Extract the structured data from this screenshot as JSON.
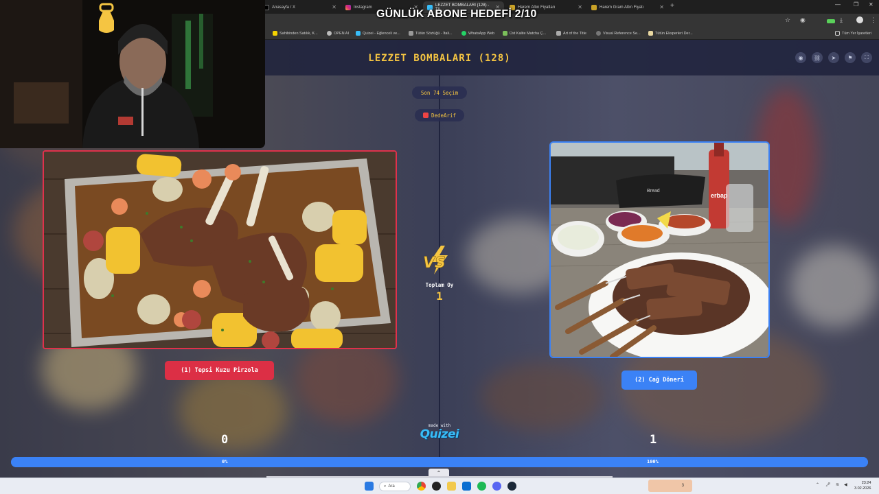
{
  "overlay": {
    "title": "GÜNLÜK ABONE HEDEFİ 2/10"
  },
  "browser": {
    "tabs": [
      {
        "label": "Anasayfa / X"
      },
      {
        "label": "Instagram"
      },
      {
        "label": "LEZZET BOMBALARI (128) - Tü...",
        "active": true
      },
      {
        "label": "Harem Altın Fiyatları"
      },
      {
        "label": "Harem Gram Altın Fiyatı"
      }
    ],
    "bookmarks": [
      "Sahibinden Satılık, K...",
      "OPEN AI",
      "Quizei - Eğlenceli ve...",
      "Tütün Sözlüğü - İtali...",
      "WhatsApp Web",
      "Üst Kalite Matcha Ç...",
      "Art of the Title",
      "Visual Reference Se...",
      "Tütün Eksperleri Der..."
    ],
    "bookmarks_right": "Tüm Yer İşaretleri"
  },
  "quiz": {
    "title": "LEZZET BOMBALARI (128)",
    "round": "Son 74 Seçim",
    "player": "DedeArif",
    "vs": "VS",
    "total_label": "Toplam Oy",
    "total_value": "1",
    "left": {
      "label": "(1) Tepsi Kuzu Pirzola",
      "votes": "0",
      "percent": "0%"
    },
    "right": {
      "label": "(2) Cağ Döneri",
      "votes": "1",
      "percent": "100%"
    },
    "progress_right_fraction": 1.0,
    "made_with": "made with",
    "brand": "Quizei"
  },
  "bottle_text": "erbap",
  "plate_text": "Bread",
  "taskbar": {
    "search": "Ara",
    "notify": "3",
    "time": "23:24",
    "date": "3.02.2026"
  },
  "colors": {
    "left": "#dc2f45",
    "right": "#3b82f6",
    "accent": "#f5c542",
    "brand": "#38bdf8"
  }
}
